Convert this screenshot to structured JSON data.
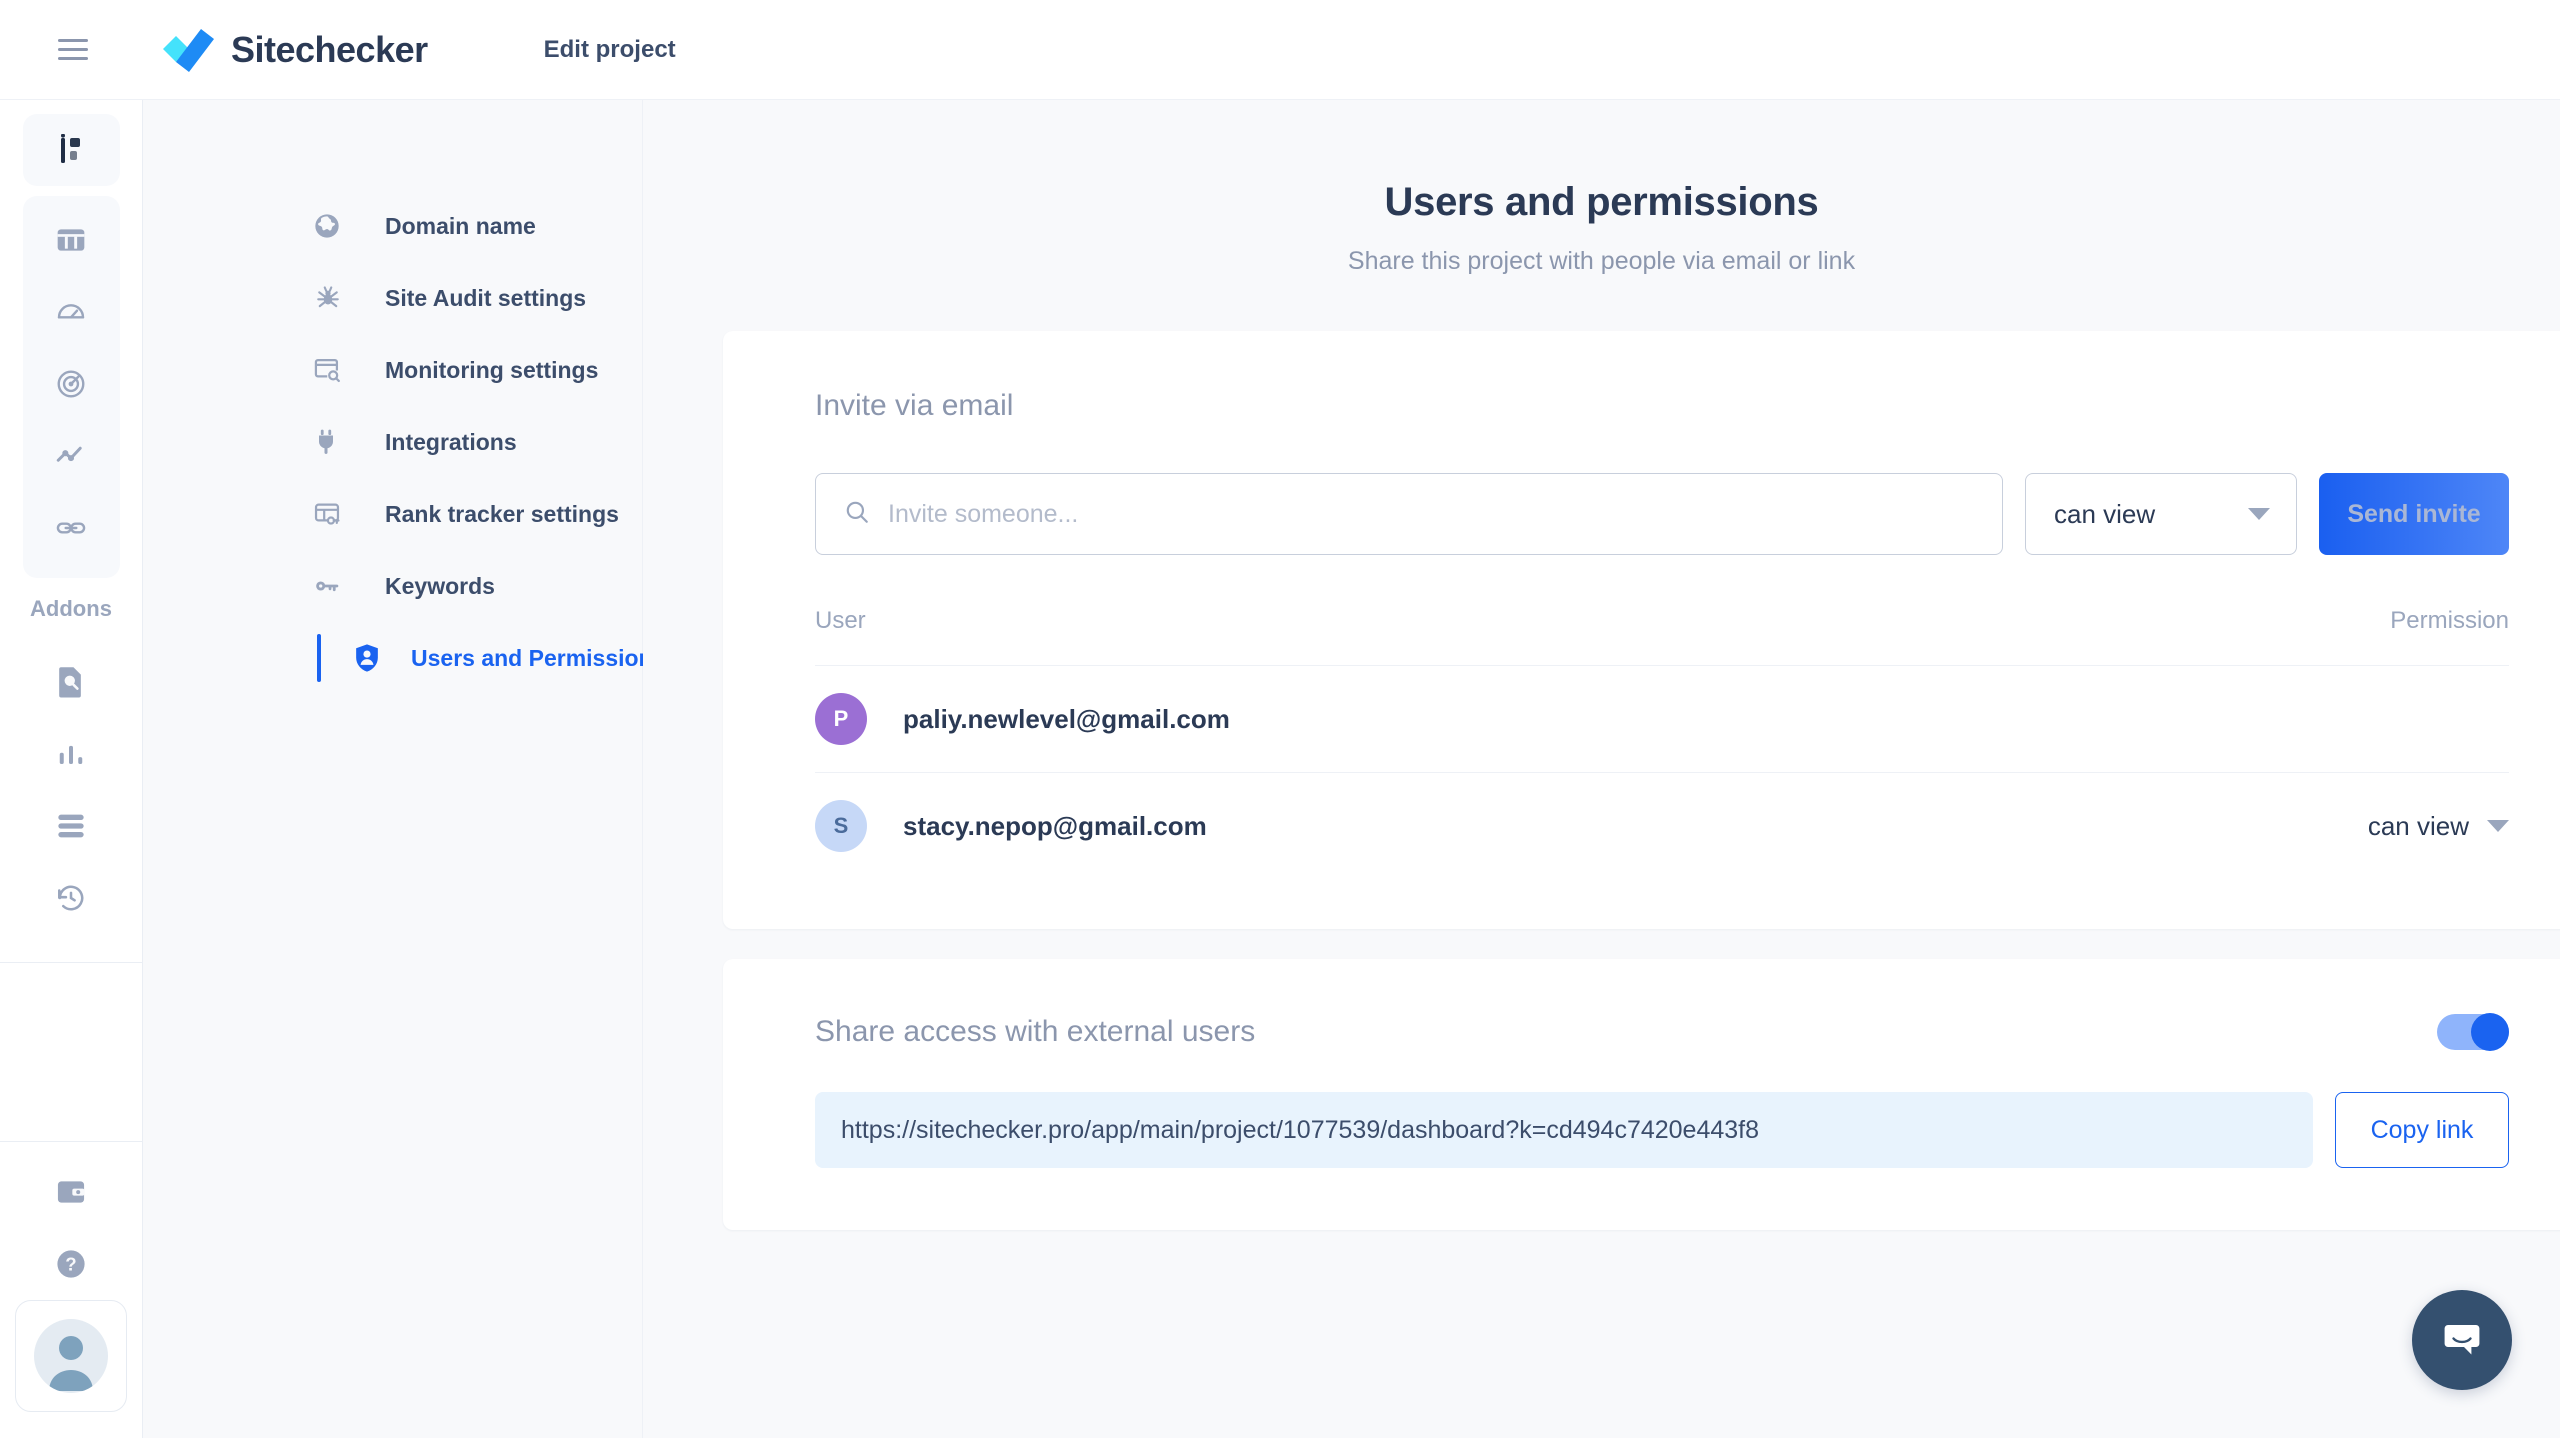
{
  "header": {
    "menu_icon": "hamburger-icon",
    "brand": "Sitechecker",
    "edit_project": "Edit project"
  },
  "rail": {
    "addons_label": "Addons",
    "top_items": [
      {
        "icon": "project-info-icon",
        "name": "project-info",
        "active": true
      }
    ],
    "primary_items": [
      {
        "icon": "dashboard-icon",
        "name": "dashboard"
      },
      {
        "icon": "speedometer-icon",
        "name": "site-audit"
      },
      {
        "icon": "target-icon",
        "name": "monitoring"
      },
      {
        "icon": "trend-line-icon",
        "name": "rank-tracker"
      },
      {
        "icon": "link-icon",
        "name": "backlinks"
      }
    ],
    "addon_items": [
      {
        "icon": "page-search-icon",
        "name": "page-analyzer"
      },
      {
        "icon": "bar-chart-icon",
        "name": "keyword-stats"
      },
      {
        "icon": "list-icon",
        "name": "bulk-list"
      },
      {
        "icon": "history-icon",
        "name": "history"
      }
    ],
    "footer_items": [
      {
        "icon": "wallet-icon",
        "name": "billing"
      },
      {
        "icon": "help-icon",
        "name": "help"
      }
    ],
    "avatar": "user-avatar"
  },
  "subnav": {
    "items": [
      {
        "label": "Domain name",
        "icon": "globe-icon",
        "active": false
      },
      {
        "label": "Site Audit settings",
        "icon": "spider-icon",
        "active": false
      },
      {
        "label": "Monitoring settings",
        "icon": "monitor-search-icon",
        "active": false
      },
      {
        "label": "Integrations",
        "icon": "plug-icon",
        "active": false
      },
      {
        "label": "Rank tracker settings",
        "icon": "rank-board-icon",
        "active": false
      },
      {
        "label": "Keywords",
        "icon": "key-icon",
        "active": false
      },
      {
        "label": "Users and Permissions",
        "icon": "shield-user-icon",
        "active": true
      }
    ]
  },
  "page": {
    "title": "Users and permissions",
    "subtitle": "Share this project with people via email or link"
  },
  "invite": {
    "section_title": "Invite via email",
    "input_value": "",
    "input_placeholder": "Invite someone...",
    "permission_selected": "can view",
    "send_label": "Send invite"
  },
  "table": {
    "col_user": "User",
    "col_permission": "Permission",
    "rows": [
      {
        "initial": "P",
        "email": "paliy.newlevel@gmail.com",
        "avatar_bg": "#9b6fd4",
        "avatar_fg": "#ffffff",
        "permission": ""
      },
      {
        "initial": "S",
        "email": "stacy.nepop@gmail.com",
        "avatar_bg": "#c6d8f7",
        "avatar_fg": "#4a6b9b",
        "permission": "can view"
      }
    ]
  },
  "share": {
    "title": "Share access with external users",
    "enabled": true,
    "link": "https://sitechecker.pro/app/main/project/1077539/dashboard?k=cd494c7420e443f8",
    "copy_label": "Copy link"
  },
  "chat": {
    "icon": "intercom-chat-icon"
  },
  "colors": {
    "accent": "#1a63f0",
    "text_dark": "#2b3a55",
    "text_muted": "#8b96ad",
    "bg": "#f8f9fb",
    "link_box": "#e8f3fd"
  }
}
